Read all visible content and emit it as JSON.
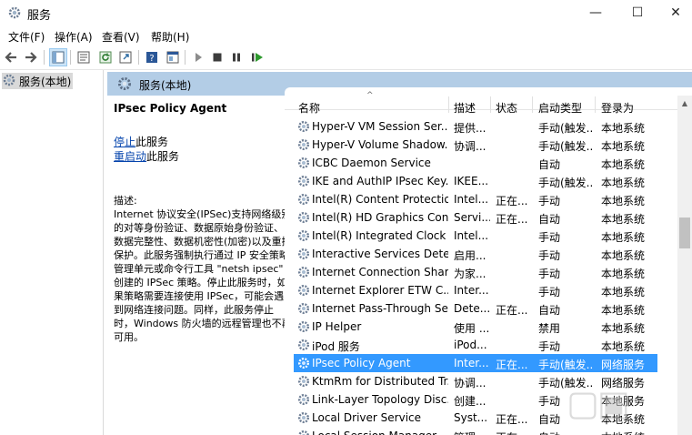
{
  "window": {
    "title": "服务",
    "minimize": "—",
    "maximize": "☐",
    "close": "✕"
  },
  "menu": [
    "文件(F)",
    "操作(A)",
    "查看(V)",
    "帮助(H)"
  ],
  "toolbar": {
    "icons": [
      "back-icon",
      "forward-icon",
      "show-tree-icon",
      "properties-icon",
      "refresh-icon",
      "export-icon",
      "help-icon",
      "console-icon",
      "start-icon",
      "stop-icon",
      "pause-icon",
      "restart-icon"
    ]
  },
  "tree": {
    "root_label": "服务(本地)"
  },
  "panel": {
    "header_label": "服务(本地)"
  },
  "details": {
    "service_name": "IPsec Policy Agent",
    "stop_link": "停止",
    "stop_suffix": "此服务",
    "restart_link": "重启动",
    "restart_suffix": "此服务",
    "desc_label": "描述:",
    "description": "Internet 协议安全(IPSec)支持网络级别的对等身份验证、数据原始身份验证、数据完整性、数据机密性(加密)以及重播保护。此服务强制执行通过 IP 安全策略管理单元或命令行工具 \"netsh ipsec\" 创建的 IPSec 策略。停止此服务时，如果策略需要连接使用 IPSec，可能会遇到网络连接问题。同样，此服务停止时，Windows 防火墙的远程管理也不再可用。"
  },
  "columns": {
    "name": "名称",
    "description": "描述",
    "status": "状态",
    "startup": "启动类型",
    "logon": "登录为"
  },
  "services": [
    {
      "name": "Hyper-V VM Session Ser...",
      "desc": "提供...",
      "status": "",
      "startup": "手动(触发...",
      "logon": "本地系统"
    },
    {
      "name": "Hyper-V Volume Shadow...",
      "desc": "协调...",
      "status": "",
      "startup": "手动(触发...",
      "logon": "本地系统"
    },
    {
      "name": "ICBC Daemon Service",
      "desc": "",
      "status": "",
      "startup": "自动",
      "logon": "本地系统"
    },
    {
      "name": "IKE and AuthIP IPsec Key...",
      "desc": "IKEE...",
      "status": "",
      "startup": "手动(触发...",
      "logon": "本地系统"
    },
    {
      "name": "Intel(R) Content Protectio...",
      "desc": "Intel...",
      "status": "正在...",
      "startup": "手动",
      "logon": "本地系统"
    },
    {
      "name": "Intel(R) HD Graphics Con...",
      "desc": "Servi...",
      "status": "正在...",
      "startup": "自动",
      "logon": "本地系统"
    },
    {
      "name": "Intel(R) Integrated Clock ...",
      "desc": "Intel...",
      "status": "",
      "startup": "手动",
      "logon": "本地系统"
    },
    {
      "name": "Interactive Services Dete...",
      "desc": "启用...",
      "status": "",
      "startup": "手动",
      "logon": "本地系统"
    },
    {
      "name": "Internet Connection Shari...",
      "desc": "为家...",
      "status": "",
      "startup": "手动",
      "logon": "本地系统"
    },
    {
      "name": "Internet Explorer ETW C...",
      "desc": "Inter...",
      "status": "",
      "startup": "手动",
      "logon": "本地系统"
    },
    {
      "name": "Internet Pass-Through Se...",
      "desc": "Dete...",
      "status": "正在...",
      "startup": "自动",
      "logon": "本地系统"
    },
    {
      "name": "IP Helper",
      "desc": "使用 ...",
      "status": "",
      "startup": "禁用",
      "logon": "本地系统"
    },
    {
      "name": "iPod 服务",
      "desc": "iPod...",
      "status": "",
      "startup": "手动",
      "logon": "本地系统"
    },
    {
      "name": "IPsec Policy Agent",
      "desc": "Inter...",
      "status": "正在...",
      "startup": "手动(触发...",
      "logon": "网络服务",
      "selected": true
    },
    {
      "name": "KtmRm for Distributed Tr...",
      "desc": "协调...",
      "status": "",
      "startup": "手动(触发...",
      "logon": "网络服务"
    },
    {
      "name": "Link-Layer Topology Disc...",
      "desc": "创建...",
      "status": "",
      "startup": "手动",
      "logon": "本地服务"
    },
    {
      "name": "Local Driver Service",
      "desc": "Syst...",
      "status": "正在...",
      "startup": "自动",
      "logon": "本地系统"
    },
    {
      "name": "Local Session Manager",
      "desc": "管理...",
      "status": "正在...",
      "startup": "自动",
      "logon": "本地系统"
    }
  ],
  "watermark": "飞沙吧"
}
